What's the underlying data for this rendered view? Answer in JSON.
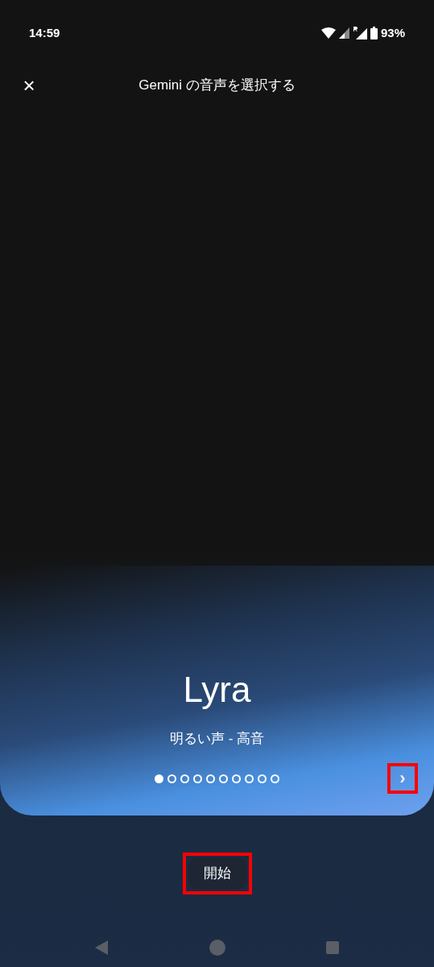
{
  "status_bar": {
    "time": "14:59",
    "battery": "93%"
  },
  "header": {
    "close": "×",
    "title": "Gemini の音声を選択する"
  },
  "voice": {
    "name": "Lyra",
    "description": "明るい声 - 高音"
  },
  "pager": [
    {
      "selected": true
    },
    {
      "selected": false
    },
    {
      "selected": false
    },
    {
      "selected": false
    },
    {
      "selected": false
    },
    {
      "selected": false
    },
    {
      "selected": false
    },
    {
      "selected": false
    },
    {
      "selected": false
    },
    {
      "selected": false
    }
  ],
  "next_button": {
    "label": "›",
    "highlighted": true
  },
  "start_button": {
    "label": "開始",
    "highlighted": true
  }
}
